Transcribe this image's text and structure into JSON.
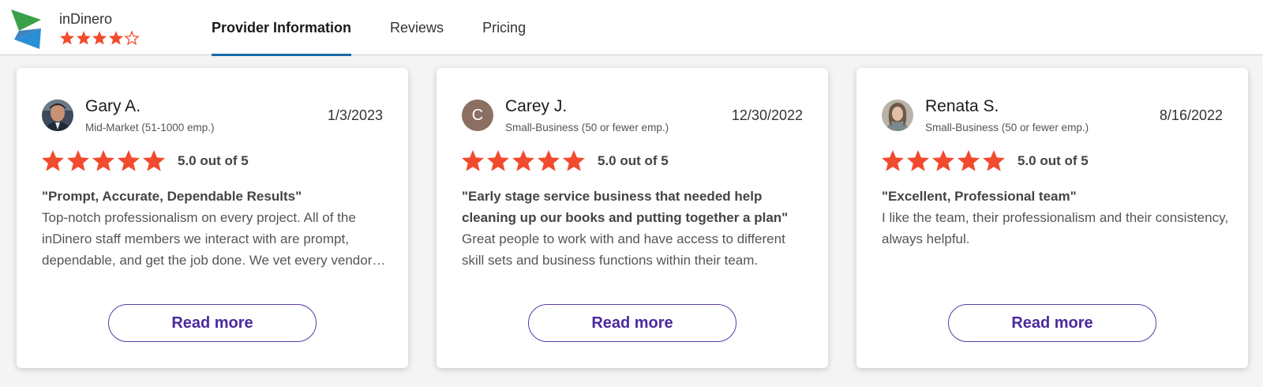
{
  "provider": {
    "name": "inDinero",
    "rating_stars": 4
  },
  "tabs": [
    {
      "label": "Provider Information",
      "active": true
    },
    {
      "label": "Reviews",
      "active": false
    },
    {
      "label": "Pricing",
      "active": false
    }
  ],
  "reviews": [
    {
      "name": "Gary A.",
      "segment": "Mid-Market (51-1000 emp.)",
      "date": "1/3/2023",
      "stars": 5,
      "rating_text": "5.0 out of 5",
      "title": "\"Prompt, Accurate, Dependable Results\"",
      "body": "Top-notch professionalism on every project. All of the inDinero staff members we interact with are prompt, dependable, and get the job done. We vet every vendor we work with carefully and inDinero continues to deliver.",
      "avatar": "photo",
      "read_more": "Read more"
    },
    {
      "name": "Carey J.",
      "segment": "Small-Business (50 or fewer emp.)",
      "date": "12/30/2022",
      "stars": 5,
      "rating_text": "5.0 out of 5",
      "title": "\"Early stage service business that needed help cleaning up our books and putting together a plan\"",
      "body": "Great people to work with and have access to different skill sets and business functions within their team.",
      "avatar": "letter",
      "avatar_letter": "C",
      "read_more": "Read more"
    },
    {
      "name": "Renata S.",
      "segment": "Small-Business (50 or fewer emp.)",
      "date": "8/16/2022",
      "stars": 5,
      "rating_text": "5.0 out of 5",
      "title": "\"Excellent, Professional team\"",
      "body": "I like the team, their professionalism and their consistency, always helpful.",
      "avatar": "photo",
      "read_more": "Read more"
    }
  ],
  "colors": {
    "star": "#f24a2d",
    "tab_underline": "#1a6aa8",
    "button_border": "#5b3aa8",
    "button_text": "#4a2a9e",
    "logo_green": "#3aa04a",
    "logo_blue": "#2a8fd6",
    "avatar_letter_bg": "#8c6e63"
  },
  "icons": {
    "star": "star-icon",
    "star_outline": "star-outline-icon",
    "logo": "indinero-logo-icon"
  }
}
